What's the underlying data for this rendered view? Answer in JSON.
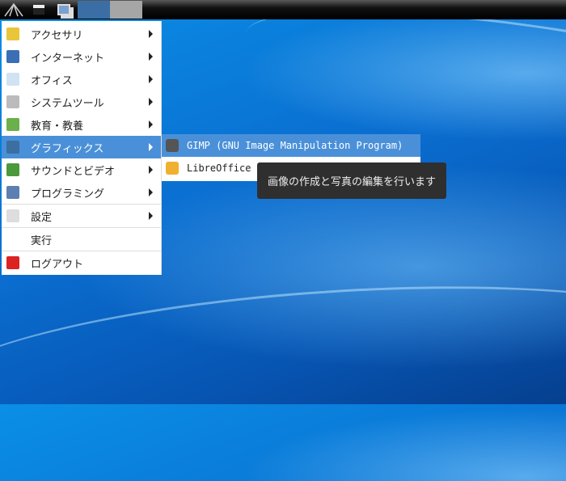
{
  "taskbar": {
    "items": [
      "lxde-logo-icon",
      "file-manager-icon",
      "show-desktop-icon",
      "window-button-1",
      "window-button-2"
    ]
  },
  "menu": {
    "items": [
      {
        "label": "アクセサリ",
        "icon": "accessories-icon",
        "submenu": true
      },
      {
        "label": "インターネット",
        "icon": "internet-icon",
        "submenu": true
      },
      {
        "label": "オフィス",
        "icon": "office-icon",
        "submenu": true
      },
      {
        "label": "システムツール",
        "icon": "system-tools-icon",
        "submenu": true
      },
      {
        "label": "教育・教養",
        "icon": "education-icon",
        "submenu": true
      },
      {
        "label": "グラフィックス",
        "icon": "graphics-icon",
        "submenu": true,
        "selected": true
      },
      {
        "label": "サウンドとビデオ",
        "icon": "sound-video-icon",
        "submenu": true
      },
      {
        "label": "プログラミング",
        "icon": "programming-icon",
        "submenu": true
      },
      {
        "label": "設定",
        "icon": "settings-icon",
        "submenu": true
      },
      {
        "label": "実行",
        "icon": "",
        "submenu": false
      },
      {
        "label": "ログアウト",
        "icon": "logout-icon",
        "submenu": false
      }
    ]
  },
  "submenu": {
    "items": [
      {
        "label": "GIMP (GNU Image Manipulation Program)",
        "icon": "gimp-icon",
        "selected": true
      },
      {
        "label": "LibreOffice Draw",
        "icon": "libreoffice-draw-icon"
      }
    ]
  },
  "tooltip": {
    "text": "画像の作成と写真の編集を行います"
  },
  "colors": {
    "highlight": "#4a90d9",
    "tooltip_bg": "#2f2f2f"
  }
}
